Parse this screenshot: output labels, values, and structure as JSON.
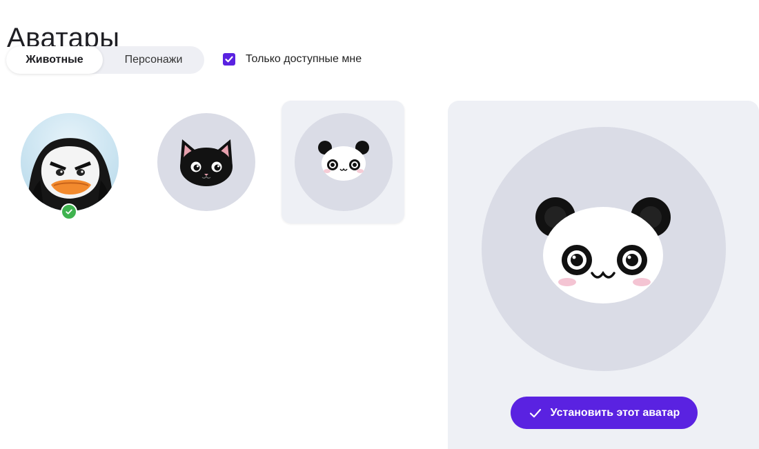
{
  "page": {
    "title": "Аватары"
  },
  "tabs": [
    {
      "label": "Животные",
      "active": true
    },
    {
      "label": "Персонажи",
      "active": false
    }
  ],
  "filter": {
    "label": "Только доступные мне",
    "checked": true
  },
  "avatars": [
    {
      "name": "penguin",
      "current": true,
      "selected": false
    },
    {
      "name": "black-cat",
      "current": false,
      "selected": false
    },
    {
      "name": "panda",
      "current": false,
      "selected": true
    }
  ],
  "preview": {
    "avatar": "panda",
    "button_label": "Установить этот аватар",
    "button_icon": "check-icon"
  },
  "colors": {
    "accent": "#5a22e1",
    "success": "#3fb34f",
    "panel": "#eef0f5",
    "avatar_bg": "#dadce6"
  }
}
